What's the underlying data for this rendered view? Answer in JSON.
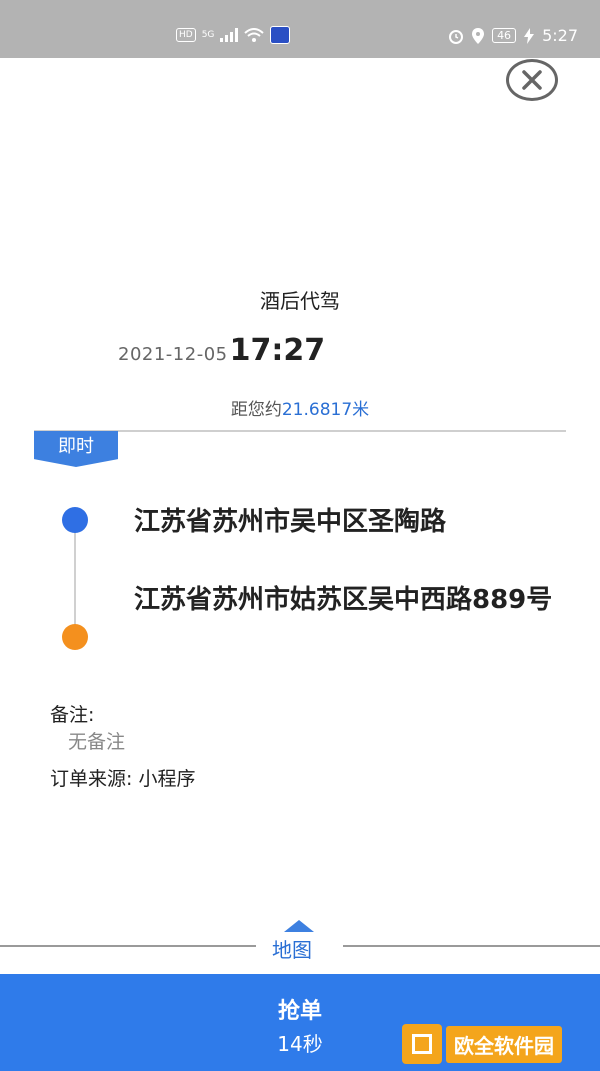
{
  "status_bar": {
    "hd": "HD",
    "signal": "5G",
    "battery": "46",
    "time": "5:27"
  },
  "order": {
    "service_type": "酒后代驾",
    "date": "2021-12-05",
    "time": "17:27",
    "distance_label": "距您约",
    "distance_value": "21.6817米",
    "tag": "即时",
    "start_address": "江苏省苏州市吴中区圣陶路",
    "end_address": "江苏省苏州市姑苏区吴中西路889号",
    "remark_label": "备注:",
    "remark_value": "无备注",
    "source_label": "订单来源:",
    "source_value": "小程序"
  },
  "map": {
    "label": "地图"
  },
  "grab": {
    "label": "抢单",
    "countdown": "14秒"
  },
  "watermark": {
    "text": "欧全软件园"
  },
  "colors": {
    "accent_blue": "#2f7bea",
    "start_dot": "#2f6fe4",
    "end_dot": "#f4901e",
    "status_bar": "#b3b3b3"
  }
}
